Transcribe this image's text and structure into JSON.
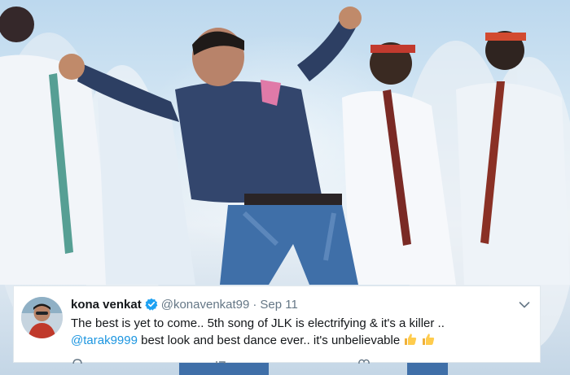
{
  "tweet": {
    "display_name": "kona venkat",
    "handle": "@konavenkat99",
    "separator": "·",
    "date": "Sep 11",
    "line1": "The best is yet to come.. 5th song of JLK is electrifying & it's a killer ..",
    "mention": "@tarak9999",
    "line2_rest": " best look and best dance ever.. it's unbelievable",
    "emoji": [
      "thumbs-up",
      "thumbs-up"
    ],
    "verified": true,
    "icons": {
      "verified": "verified-badge-icon",
      "menu": "chevron-down-icon",
      "reply": "reply-icon",
      "retweet": "retweet-icon",
      "like": "heart-icon"
    }
  },
  "colors": {
    "link": "#1b95e0",
    "verified": "#1da1f2",
    "text": "#14171a",
    "muted": "#657786"
  }
}
